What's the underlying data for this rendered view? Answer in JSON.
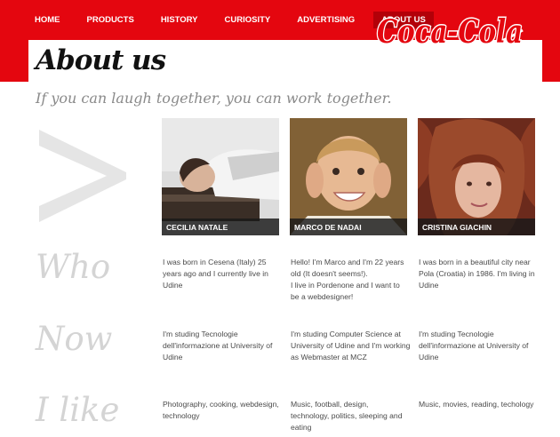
{
  "nav": {
    "items": [
      {
        "label": "HOME"
      },
      {
        "label": "PRODUCTS"
      },
      {
        "label": "HISTORY"
      },
      {
        "label": "CURIOSITY"
      },
      {
        "label": "ADVERTISING"
      },
      {
        "label": "ABOUT US",
        "active": true
      }
    ]
  },
  "logo": {
    "text": "Coca-Cola"
  },
  "page": {
    "title": "About us",
    "tagline": "If you can laugh together, you can work together."
  },
  "decoration": {
    "chevron": ">"
  },
  "team": [
    {
      "name": "CECILIA NATALE"
    },
    {
      "name": "MARCO DE NADAI"
    },
    {
      "name": "CRISTINA GIACHIN"
    }
  ],
  "rows": [
    {
      "label": "Who",
      "cells": [
        "I was born in Cesena (Italy) 25\nyears ago and I currently live in\nUdine",
        "Hello! I'm Marco and I'm 22 years\nold (It doesn't seems!).\nI live in Pordenone and I want to\nbe a webdesigner!",
        "I was born in a beautiful city near\nPola (Croatia) in 1986. I'm living in\nUdine"
      ]
    },
    {
      "label": "Now",
      "cells": [
        "I'm studing Tecnologie\ndell'informazione at University of\nUdine",
        "I'm studing Computer Science at\nUniversity of Udine and I'm working\nas Webmaster at MCZ",
        "I'm studing Tecnologie\ndell'informazione at University of\nUdine"
      ]
    },
    {
      "label": "I like",
      "cells": [
        "Photography, cooking, webdesign,\ntechnology",
        "Music, football, design,\ntechnology, politics, sleeping and\neating",
        "Music, movies, reading, techology"
      ]
    }
  ],
  "colors": {
    "brand_red": "#e4060f",
    "active_nav": "#b30008"
  }
}
